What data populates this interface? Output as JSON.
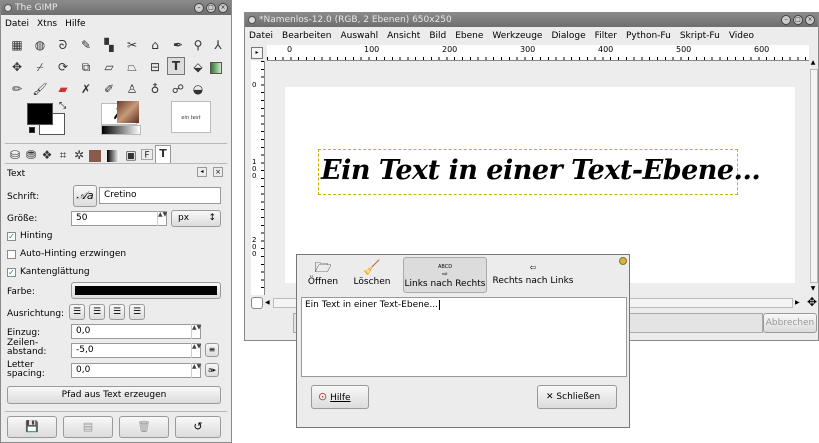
{
  "toolbox": {
    "title": "The GIMP",
    "menu": [
      "Datei",
      "Xtns",
      "Hilfe"
    ],
    "tools_row1": [
      "rect-select",
      "ellipse-select",
      "free-select",
      "fuzzy-select",
      "color-select",
      "scissors",
      "foreground-select",
      "paths",
      "color-picker",
      "zoom"
    ],
    "fg_color": "#000000",
    "bg_color": "#ffffff",
    "tabs_panel_title": "Text",
    "font_label": "Schrift:",
    "font_value": "Cretino",
    "size_label": "Größe:",
    "size_value": "50",
    "size_unit": "px",
    "hinting_label": "Hinting",
    "autohint_label": "Auto-Hinting erzwingen",
    "antialias_label": "Kantenglättung",
    "color_label": "Farbe:",
    "color_value": "#000000",
    "justify_label": "Ausrichtung:",
    "indent_label": "Einzug:",
    "indent_value": "0,0",
    "linespacing_label": "Zeilen-\nabstand:",
    "linespacing_value": "-5,0",
    "letterspacing_label": "Letter\nspacing:",
    "letterspacing_value": "0,0",
    "path_button": "Pfad aus Text erzeugen"
  },
  "image": {
    "title": "*Namenlos-12.0 (RGB, 2 Ebenen) 650x250",
    "menu": [
      "Datei",
      "Bearbeiten",
      "Auswahl",
      "Ansicht",
      "Bild",
      "Ebene",
      "Werkzeuge",
      "Dialoge",
      "Filter",
      "Python-Fu",
      "Skript-Fu",
      "Video"
    ],
    "ruler_ticks": [
      "0",
      "100",
      "200",
      "300",
      "400",
      "500",
      "600"
    ],
    "vruler_ticks": [
      "0",
      "1\n0\n0",
      "2\n0\n0"
    ],
    "canvas_text": "Ein Text in einer Text-Ebene...",
    "cancel_label": "Abbrechen"
  },
  "editor": {
    "buttons": [
      {
        "label": "Öffnen",
        "icon": "folder-icon"
      },
      {
        "label": "Löschen",
        "icon": "clear-icon"
      },
      {
        "label": "Links nach Rechts",
        "icon": "ltr-icon",
        "small": "ABCD"
      },
      {
        "label": "Rechts nach Links",
        "icon": "rtl-icon",
        "small": "ABCD"
      }
    ],
    "text": "Ein Text in einer Text-Ebene...",
    "help_label": "Hilfe",
    "close_label": "Schließen"
  },
  "colors": {
    "selection": "#d0c000",
    "accent": "#2a6fb8"
  }
}
